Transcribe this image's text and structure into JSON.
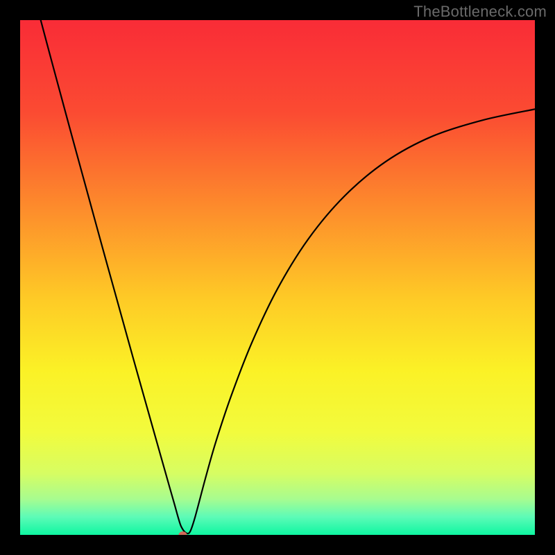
{
  "watermark": "TheBottleneck.com",
  "chart_data": {
    "type": "line",
    "title": "",
    "xlabel": "",
    "ylabel": "",
    "xlim": [
      0,
      100
    ],
    "ylim": [
      0,
      100
    ],
    "gradient_stops": [
      {
        "offset": 0.0,
        "color": "#f92c37"
      },
      {
        "offset": 0.18,
        "color": "#fb4b32"
      },
      {
        "offset": 0.36,
        "color": "#fd8a2c"
      },
      {
        "offset": 0.54,
        "color": "#feca26"
      },
      {
        "offset": 0.68,
        "color": "#fbf126"
      },
      {
        "offset": 0.8,
        "color": "#f2fb3d"
      },
      {
        "offset": 0.88,
        "color": "#d7fd62"
      },
      {
        "offset": 0.93,
        "color": "#a8fc8f"
      },
      {
        "offset": 0.965,
        "color": "#5dfbb7"
      },
      {
        "offset": 1.0,
        "color": "#0ef6a1"
      }
    ],
    "series": [
      {
        "name": "bottleneck-curve",
        "x": [
          4,
          6,
          8,
          10,
          12,
          14,
          16,
          18,
          20,
          22,
          24,
          26,
          27.5,
          29,
          30,
          30.7,
          31.3,
          32.2,
          33,
          34,
          36,
          38,
          41,
          45,
          50,
          56,
          63,
          71,
          80,
          90,
          100
        ],
        "y": [
          100,
          92.5,
          85.1,
          77.7,
          70.4,
          63.1,
          55.8,
          48.6,
          41.4,
          34.2,
          27.1,
          20.0,
          14.7,
          9.4,
          5.9,
          3.4,
          1.6,
          0.4,
          0.6,
          3.5,
          11.0,
          18.0,
          27.0,
          37.3,
          47.8,
          57.5,
          65.8,
          72.5,
          77.4,
          80.6,
          82.7
        ]
      }
    ],
    "marker": {
      "x": 31.6,
      "y": 0.0,
      "color": "#d06a5a",
      "rx": 6,
      "ry": 5
    }
  }
}
